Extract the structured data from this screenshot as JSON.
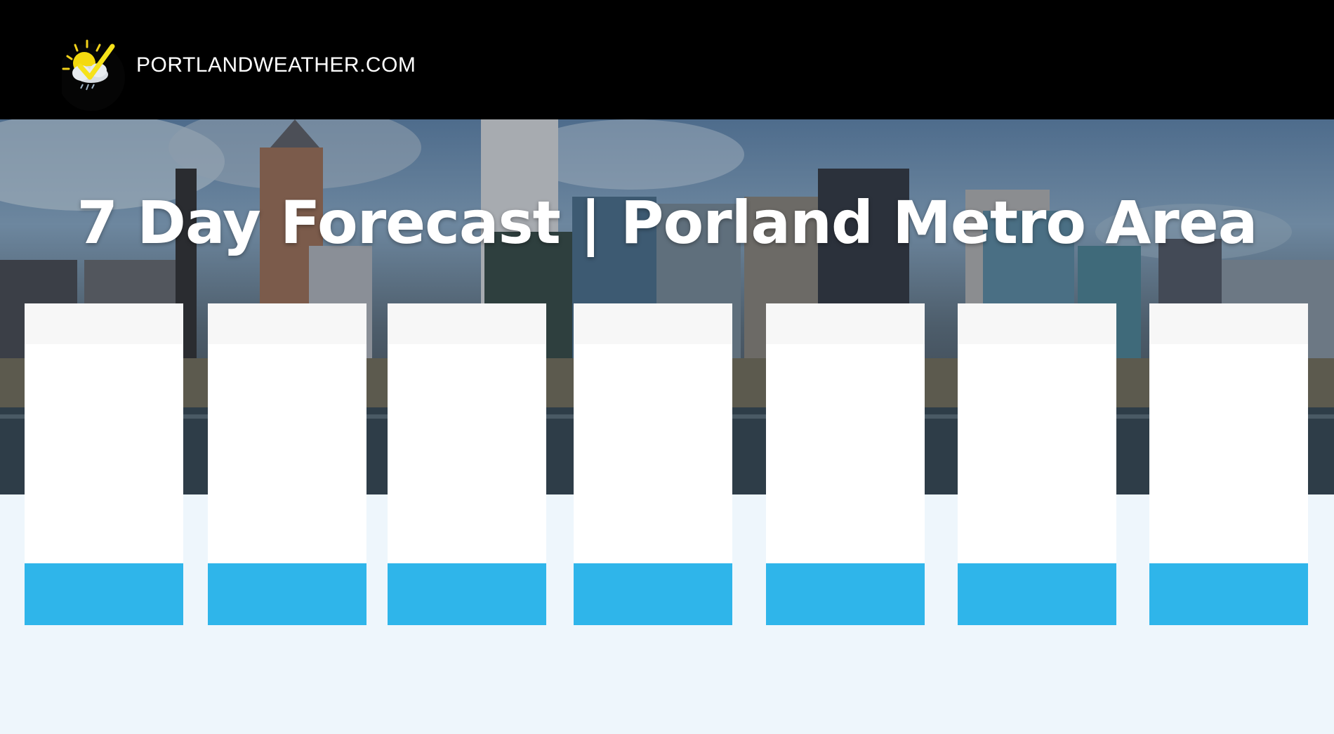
{
  "header": {
    "logo_icon": "sun-cloud-check-logo-icon",
    "site_name": "PORTLANDWEATHER.COM"
  },
  "hero": {
    "title": "7 Day Forecast | Porland Metro Area"
  },
  "forecast_cards": [
    {
      "id": "day-1"
    },
    {
      "id": "day-2"
    },
    {
      "id": "day-3"
    },
    {
      "id": "day-4"
    },
    {
      "id": "day-5"
    },
    {
      "id": "day-6"
    },
    {
      "id": "day-7"
    }
  ],
  "colors": {
    "header_bg": "#000000",
    "card_accent": "#2fb5ea",
    "page_bg": "#eef6fc"
  }
}
